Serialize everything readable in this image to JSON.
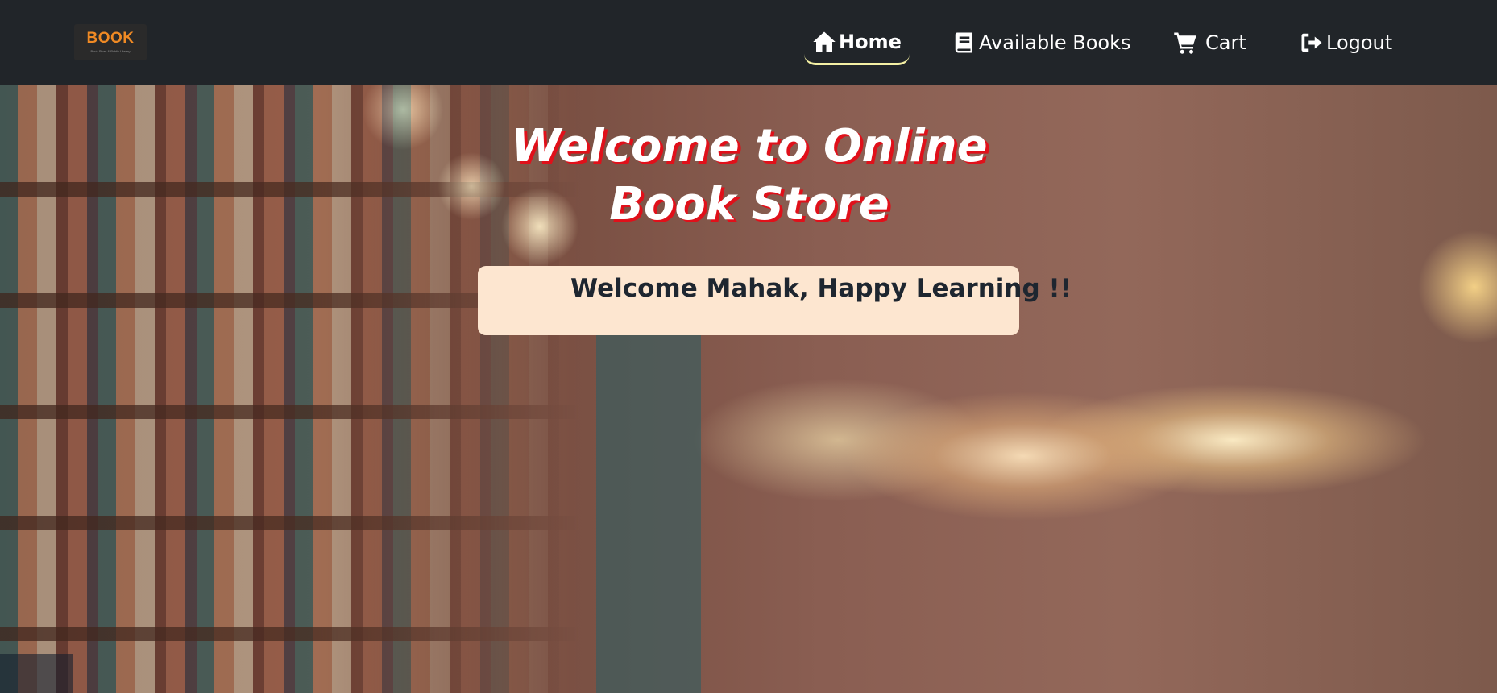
{
  "nav": {
    "logo_text": "BOOK",
    "logo_subtext": "Book Store & Public Library",
    "items": [
      {
        "label": "Home",
        "icon": "home-icon",
        "active": true
      },
      {
        "label": "Available Books",
        "icon": "book-icon",
        "active": false
      },
      {
        "label": "Cart",
        "icon": "cart-icon",
        "active": false
      },
      {
        "label": "Logout",
        "icon": "logout-icon",
        "active": false
      }
    ]
  },
  "hero": {
    "title_line1": "Welcome to Online",
    "title_line2": "Book Store",
    "welcome_message": "Welcome Mahak, Happy Learning !!"
  },
  "colors": {
    "navbar": "#212529",
    "active_underline": "#f4f0a4",
    "title_shadow": "#e0101a",
    "welcome_box": "#fde6d0",
    "logo_accent": "#f08a24"
  }
}
